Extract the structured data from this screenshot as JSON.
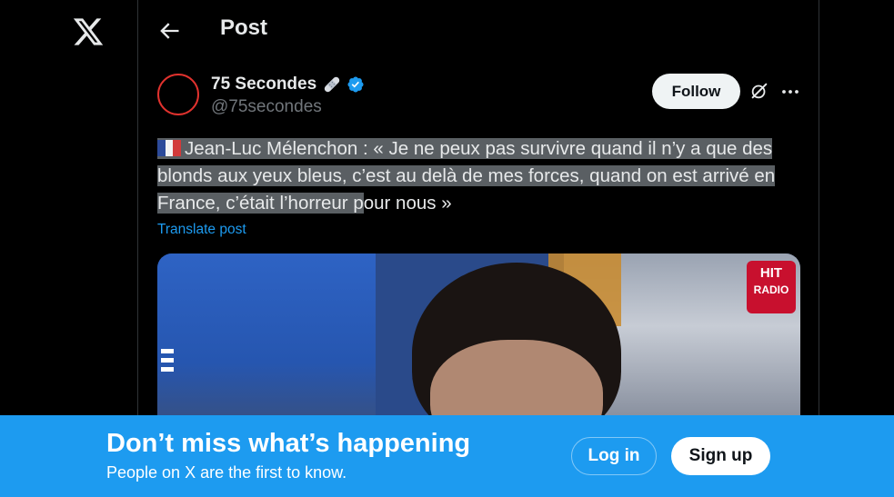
{
  "nav": {
    "logo_icon": "x-logo-icon",
    "back_icon": "arrow-left-icon"
  },
  "header": {
    "title": "Post"
  },
  "post": {
    "author_name": "75 Secondes",
    "author_badge_icon": "bandage-emoji",
    "verified_icon": "verified-badge-icon",
    "handle": "@75secondes",
    "follow_label": "Follow",
    "grok_icon": "grok-icon",
    "more_icon": "more-dots-icon",
    "flag_icon": "france-flag-emoji",
    "text_highlighted": "Jean-Luc Mélenchon : « Je ne peux pas survivre quand il n’y a que des blonds aux yeux bleus, c’est au delà de mes forces, quand on est arrivé en France, c’était l’horreur p",
    "text_rest": "our nous »",
    "translate_label": "Translate post",
    "media_logo_line1": "HIT",
    "media_logo_line2": "RADIO"
  },
  "banner": {
    "title": "Don’t miss what’s happening",
    "subtitle": "People on X are the first to know.",
    "login_label": "Log in",
    "signup_label": "Sign up"
  },
  "colors": {
    "background": "#000000",
    "accent": "#1d9bf0",
    "highlight": "#5a5f63",
    "avatar_ring": "#e0322e"
  }
}
